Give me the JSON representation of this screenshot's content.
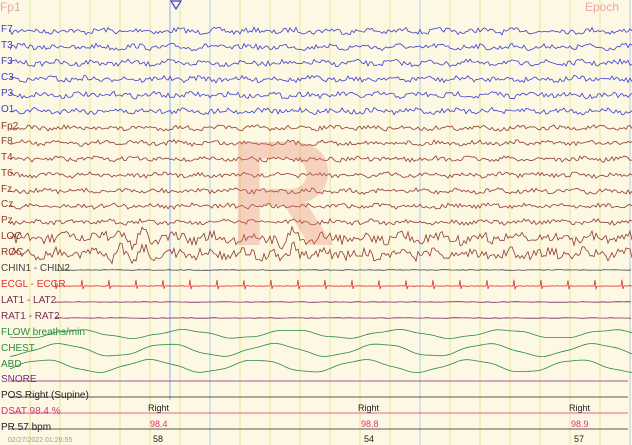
{
  "corner_left": "Fp1",
  "corner_right": "Epoch",
  "stage": "R",
  "timestamp": "02/27/2022 01:26:55",
  "colors": {
    "eeg": "#3c3ccd",
    "eog": "#8c3a2a",
    "chin": "#444444",
    "ecg": "#e03030",
    "leg": "#7a2a5a",
    "resp": "#2a8a3a",
    "snore": "#7a2a7a",
    "pos": "#222222",
    "sat": "#e03070",
    "pr": "#222222",
    "gridYellow": "#d8d860",
    "gridBlue": "#9cc0e8"
  },
  "channels": [
    {
      "label": "F7",
      "type": "eeg"
    },
    {
      "label": "T3",
      "type": "eeg"
    },
    {
      "label": "F3",
      "type": "eeg"
    },
    {
      "label": "C3",
      "type": "eeg"
    },
    {
      "label": "P3",
      "type": "eeg"
    },
    {
      "label": "O1",
      "type": "eeg"
    },
    {
      "label": "Fp2",
      "type": "eog"
    },
    {
      "label": "F8",
      "type": "eog"
    },
    {
      "label": "T4",
      "type": "eog"
    },
    {
      "label": "T6",
      "type": "eog"
    },
    {
      "label": "Fz",
      "type": "eog"
    },
    {
      "label": "Cz",
      "type": "eog"
    },
    {
      "label": "Pz",
      "type": "eog"
    },
    {
      "label": "LOC",
      "type": "eog"
    },
    {
      "label": "ROC",
      "type": "eog"
    },
    {
      "label": "CHIN1 - CHIN2",
      "type": "chin"
    },
    {
      "label": "ECGL - ECGR",
      "type": "ecg"
    },
    {
      "label": "LAT1 - LAT2",
      "type": "leg"
    },
    {
      "label": "RAT1 - RAT2",
      "type": "leg"
    },
    {
      "label": "FLOW breaths/min",
      "type": "resp"
    },
    {
      "label": "CHEST",
      "type": "resp"
    },
    {
      "label": "ABD",
      "type": "resp"
    },
    {
      "label": "SNORE",
      "type": "snore"
    },
    {
      "label": "POS Right (Supine)",
      "type": "pos"
    },
    {
      "label": "DSAT 98.4 %",
      "type": "sat"
    },
    {
      "label": "PR  57 bpm",
      "type": "pr"
    }
  ],
  "position_values": [
    "Right",
    "Right",
    "Right"
  ],
  "sat_values": [
    "98.4",
    "98.8",
    "98.9"
  ],
  "pr_values": [
    "58",
    "54",
    "57"
  ]
}
